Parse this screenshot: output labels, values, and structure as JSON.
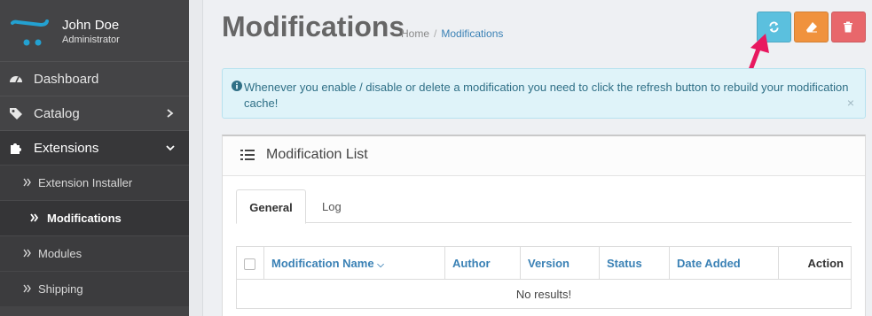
{
  "user": {
    "name": "John Doe",
    "role": "Administrator"
  },
  "sidebar": {
    "items": [
      {
        "label": "Dashboard",
        "icon": "dashboard-icon"
      },
      {
        "label": "Catalog",
        "icon": "tags-icon"
      },
      {
        "label": "Extensions",
        "icon": "puzzle-icon"
      }
    ],
    "submenu": [
      {
        "label": "Extension Installer"
      },
      {
        "label": "Modifications"
      },
      {
        "label": "Modules"
      },
      {
        "label": "Shipping"
      }
    ]
  },
  "header": {
    "title": "Modifications",
    "breadcrumb": {
      "home": "Home",
      "separator": "/",
      "current": "Modifications"
    },
    "buttons": [
      {
        "name": "refresh",
        "icon": "refresh-icon",
        "color": "#5bc0de"
      },
      {
        "name": "clear",
        "icon": "eraser-icon",
        "color": "#f0923d"
      },
      {
        "name": "delete",
        "icon": "trash-icon",
        "color": "#e8676b"
      }
    ],
    "annotation_arrow_color": "#e8185f"
  },
  "alert": {
    "text": "Whenever you enable / disable or delete a modification you need to click the refresh button to rebuild your modification cache!",
    "close": "×"
  },
  "panel": {
    "title": "Modification List",
    "tabs": [
      {
        "label": "General",
        "active": true
      },
      {
        "label": "Log",
        "active": false
      }
    ],
    "table": {
      "columns": [
        "Modification Name",
        "Author",
        "Version",
        "Status",
        "Date Added",
        "Action"
      ],
      "empty_message": "No results!"
    }
  },
  "colors": {
    "sidebar_bg": "#444446",
    "link": "#3a81b5",
    "alert_bg": "#dff3f9"
  }
}
